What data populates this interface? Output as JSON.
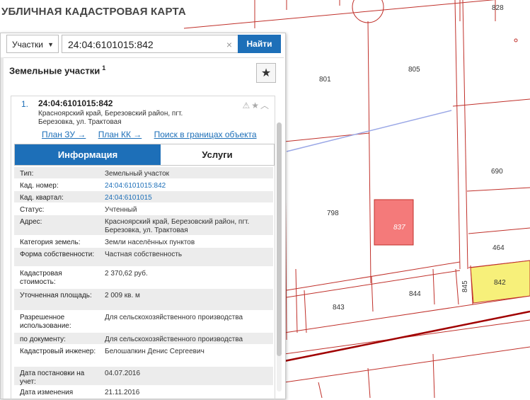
{
  "app": {
    "title": "УБЛИЧНАЯ КАДАСТРОВАЯ КАРТА"
  },
  "search": {
    "type_label": "Участки",
    "query": "24:04:6101015:842",
    "button_label": "Найти",
    "clear_glyph": "×"
  },
  "section": {
    "title": "Земельные участки",
    "count": "1",
    "favorite_glyph": "★"
  },
  "card": {
    "number": "1.",
    "title": "24:04:6101015:842",
    "address": "Красноярский край, Березовский район, пгт. Березовка, ул. Трактовая",
    "icons": "⚠★︿",
    "links": [
      "План ЗУ →",
      "План КК →",
      "Поиск в границах объекта →"
    ],
    "tabs": [
      "Информация",
      "Услуги"
    ],
    "details": [
      {
        "key": "Тип:",
        "value": "Земельный участок"
      },
      {
        "key": "Кад. номер:",
        "value": "24:04:6101015:842",
        "link": true
      },
      {
        "key": "Кад. квартал:",
        "value": "24:04:6101015",
        "link": true
      },
      {
        "key": "Статус:",
        "value": "Учтенный"
      },
      {
        "key": "Адрес:",
        "value": "Красноярский край, Березовский район, пгт. Березовка, ул. Трактовая"
      },
      {
        "key": "Категория земель:",
        "value": "Земли населённых пунктов"
      },
      {
        "key": "Форма собственности:",
        "value": "Частная собственность"
      },
      {
        "key": "Кадастровая стоимость:",
        "value": "2 370,62 руб."
      },
      {
        "key": "Уточненная площадь:",
        "value": "2 009 кв. м"
      },
      {
        "key": "Разрешенное использование:",
        "value": "Для сельскохозяйственного производства"
      },
      {
        "key": "по документу:",
        "value": "Для сельскохозяйственного производства"
      },
      {
        "key": "Кадастровый инженер:",
        "value": "Белошапкин Денис Сергеевич"
      },
      {
        "key": "Дата постановки на учет:",
        "value": "04.07.2016"
      },
      {
        "key": "Дата изменения",
        "value": "21.11.2016"
      }
    ]
  },
  "map": {
    "labels": [
      "828",
      "801",
      "805",
      "690",
      "798",
      "837",
      "464",
      "842",
      "844",
      "845",
      "843"
    ],
    "colors": {
      "parcel_line": "#c0302a",
      "highlight_fill": "#f7f07a",
      "selected_fill": "#f47a7a",
      "road_line": "#a00000"
    }
  }
}
